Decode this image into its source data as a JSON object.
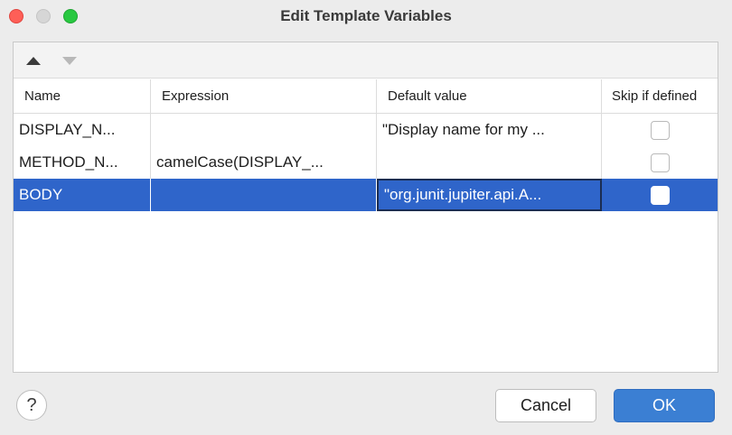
{
  "window": {
    "title": "Edit Template Variables"
  },
  "columns": [
    "Name",
    "Expression",
    "Default value",
    "Skip if defined"
  ],
  "rows": [
    {
      "name": "DISPLAY_N...",
      "expression": "",
      "default_value": "\"Display name for my ...",
      "skip_if_defined": false
    },
    {
      "name": "METHOD_N...",
      "expression": "camelCase(DISPLAY_...",
      "default_value": "",
      "skip_if_defined": false
    },
    {
      "name": "BODY",
      "expression": "",
      "default_value": "\"org.junit.jupiter.api.A...",
      "skip_if_defined": false
    }
  ],
  "footer": {
    "help_label": "?",
    "cancel_label": "Cancel",
    "ok_label": "OK"
  },
  "colors": {
    "selection": "#2f65ca",
    "ok_button": "#3b7fd3",
    "close": "#fe5f57",
    "maximize": "#28c840"
  }
}
